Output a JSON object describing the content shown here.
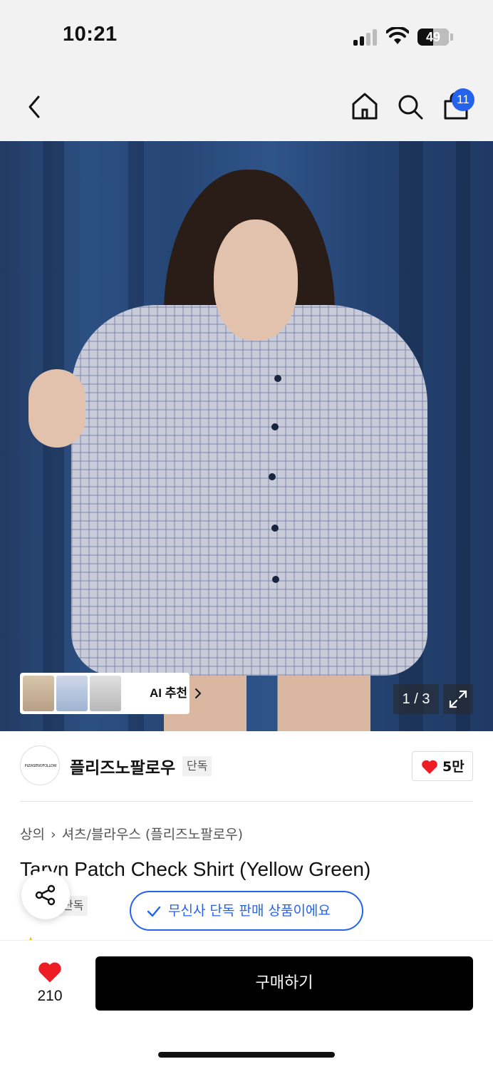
{
  "status_bar": {
    "time": "10:21",
    "battery_level": "49"
  },
  "nav": {
    "cart_count": "11"
  },
  "product_image": {
    "counter": "1 / 3",
    "ai_recommend_label": "AI 추천"
  },
  "brand": {
    "logo_text": "PLEASENOFOLLOW",
    "name": "플리즈노팔로우",
    "exclusive_tag": "단독",
    "like_count": "5만"
  },
  "breadcrumb": [
    "상의",
    "셔츠/블라우스 (플리즈노팔로우)"
  ],
  "product": {
    "title": "Taryn Patch Check Shirt (Yellow Green)",
    "tag": "단독"
  },
  "toast": {
    "text": "무신사 단독 판매 상품이에요"
  },
  "bottom_bar": {
    "wish_count": "210",
    "buy_label": "구매하기"
  },
  "colors": {
    "accent_blue": "#2563eb",
    "heart_red": "#ee1c25",
    "buy_black": "#000000"
  }
}
